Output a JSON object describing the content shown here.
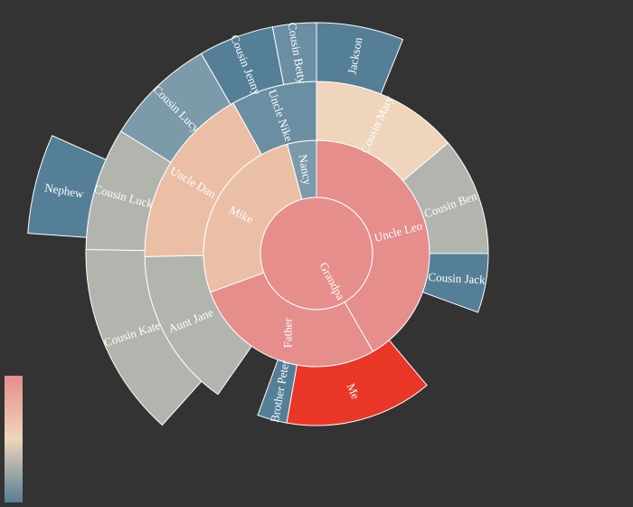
{
  "chart_data": {
    "type": "sunburst",
    "title": "",
    "palette": {
      "background": "#333333",
      "depth1": "#e68e8c",
      "depth2_peach": "#ebbfa6",
      "depth2_gray": "#b2b5ad",
      "depth3_blue_dark": "#557f96",
      "depth3_blue_mid": "#6a8ea2",
      "depth3_blue_light": "#7b9aaa",
      "highlight": "#ea3627",
      "cream": "#efd5bb",
      "stroke": "#ffffff"
    },
    "visual_map": {
      "orient": "vertical",
      "position": "bottom-left",
      "colors": [
        "#e68e8c",
        "#efd5bb",
        "#557f96"
      ]
    },
    "root": {
      "name": "Grandpa",
      "children": [
        {
          "name": "Uncle Leo",
          "value": 15,
          "children": [
            {
              "name": "Cousin Jack",
              "value": 2
            },
            {
              "name": "Cousin Mary",
              "value": 5,
              "children": [
                {
                  "name": "Jackson",
                  "value": 2
                }
              ]
            },
            {
              "name": "Cousin Ben",
              "value": 4
            }
          ]
        },
        {
          "name": "Father",
          "value": 10,
          "children": [
            {
              "name": "Me",
              "value": 5
            },
            {
              "name": "Brother Peter",
              "value": 1
            }
          ]
        },
        {
          "name": "Mike",
          "value": 11,
          "children": [
            {
              "name": "Aunt Jane",
              "children": [
                {
                  "name": "Cousin Kate"
                }
              ]
            },
            {
              "name": "Uncle Dan",
              "children": [
                {
                  "name": "Cousin Lucy"
                },
                {
                  "name": "Cousin Luck",
                  "children": [
                    {
                      "name": "Nephew"
                    }
                  ]
                }
              ]
            },
            {
              "name": "Uncle Nike",
              "children": [
                {
                  "name": "Cousin Jenny"
                }
              ]
            }
          ]
        },
        {
          "name": "Nancy",
          "children": [
            {
              "name": "Cousin Betty"
            }
          ]
        }
      ]
    },
    "segments": [
      {
        "id": "grandpa",
        "label": "Grandpa",
        "depth": 0,
        "start": 0,
        "end": 360,
        "rotate": 62,
        "color": "depth1"
      },
      {
        "id": "uncle-leo",
        "label": "Uncle Leo",
        "depth": 1,
        "start": 0,
        "end": 150,
        "rotate": -15,
        "color": "depth1"
      },
      {
        "id": "father",
        "label": "Father",
        "depth": 1,
        "start": 150,
        "end": 250,
        "rotate": -90,
        "color": "depth1"
      },
      {
        "id": "mike",
        "label": "Mike",
        "depth": 1,
        "start": 250,
        "end": 345,
        "rotate": 27,
        "color": "depth2_peach"
      },
      {
        "id": "nancy",
        "label": "Nancy",
        "depth": 1,
        "start": 345,
        "end": 360,
        "rotate": 80,
        "color": "depth3_blue_light"
      },
      {
        "id": "cousin-mary",
        "label": "Cousin Mary",
        "depth": 2,
        "start": 0,
        "end": 50,
        "rotate": -65,
        "color": "cream"
      },
      {
        "id": "cousin-ben",
        "label": "Cousin Ben",
        "depth": 2,
        "start": 50,
        "end": 90,
        "rotate": -20,
        "color": "depth2_gray"
      },
      {
        "id": "cousin-jack",
        "label": "Cousin Jack",
        "depth": 2,
        "start": 90,
        "end": 110,
        "rotate": 3,
        "color": "depth3_blue_dark"
      },
      {
        "id": "me",
        "label": "Me",
        "depth": 2,
        "start": 140,
        "end": 190,
        "rotate": 67,
        "color": "highlight"
      },
      {
        "id": "brother-peter",
        "label": "Brother Peter",
        "depth": 2,
        "start": 190,
        "end": 200,
        "rotate": -80,
        "color": "depth3_blue_dark"
      },
      {
        "id": "aunt-jane",
        "label": "Aunt Jane",
        "depth": 2,
        "start": 215,
        "end": 269,
        "rotate": -22,
        "color": "depth2_gray"
      },
      {
        "id": "uncle-dan",
        "label": "Uncle Dan",
        "depth": 2,
        "start": 269,
        "end": 331,
        "rotate": 30,
        "color": "depth2_peach"
      },
      {
        "id": "uncle-nike",
        "label": "Uncle Nike",
        "depth": 2,
        "start": 331,
        "end": 360,
        "rotate": 71,
        "color": "depth3_blue_mid"
      },
      {
        "id": "jackson",
        "label": "Jackson",
        "depth": 3,
        "start": 0,
        "end": 22,
        "rotate": -80,
        "color": "depth3_blue_dark"
      },
      {
        "id": "cousin-kate",
        "label": "Cousin Kate",
        "depth": 3,
        "start": 222,
        "end": 271,
        "rotate": -18,
        "color": "depth2_gray"
      },
      {
        "id": "cousin-luck",
        "label": "Cousin Luck",
        "depth": 3,
        "start": 271,
        "end": 302,
        "rotate": 15,
        "color": "depth2_gray"
      },
      {
        "id": "cousin-lucy",
        "label": "Cousin Lucy",
        "depth": 3,
        "start": 302,
        "end": 330,
        "rotate": 45,
        "color": "depth3_blue_light"
      },
      {
        "id": "cousin-jenny",
        "label": "Cousin Jenny",
        "depth": 3,
        "start": 330,
        "end": 349,
        "rotate": 68,
        "color": "depth3_blue_dark"
      },
      {
        "id": "cousin-betty",
        "label": "Cousin Betty",
        "depth": 3,
        "start": 349,
        "end": 360,
        "rotate": 80,
        "color": "depth3_blue_mid"
      },
      {
        "id": "nephew",
        "label": "Nephew",
        "depth": 4,
        "start": 274,
        "end": 294,
        "rotate": 10,
        "color": "depth3_blue_dark"
      }
    ]
  }
}
